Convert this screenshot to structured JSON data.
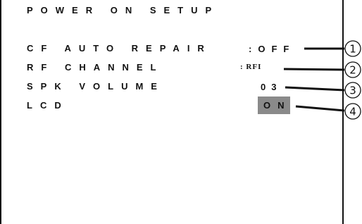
{
  "menu": {
    "title": "POWER ON SETUP",
    "items": [
      {
        "label": "CF AUTO REPAIR",
        "value": ":OFF"
      },
      {
        "label": "RF CHANNEL",
        "value": ": RFI"
      },
      {
        "label": "SPK VOLUME",
        "value": "03"
      },
      {
        "label": "LCD",
        "value": "ON"
      }
    ]
  },
  "callouts": [
    "1",
    "2",
    "3",
    "4"
  ],
  "colors": {
    "highlight": "#8a8a8a",
    "text": "#111111",
    "background": "#ffffff"
  }
}
